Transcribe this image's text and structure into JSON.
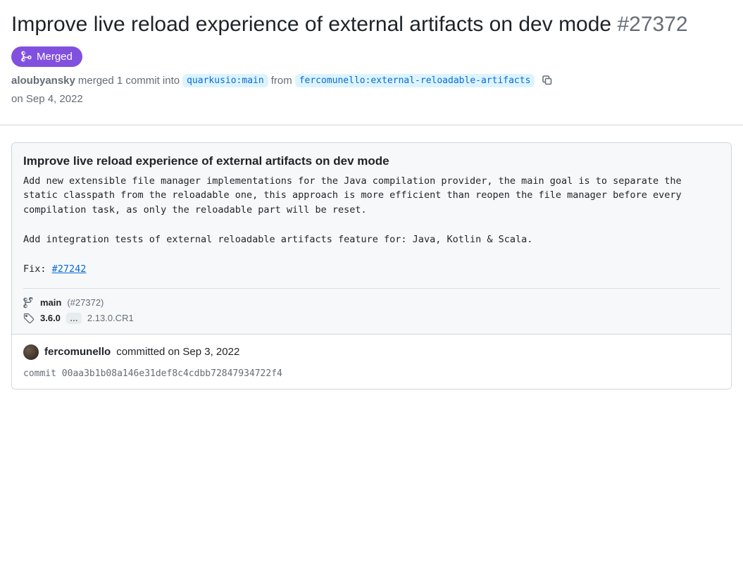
{
  "header": {
    "title": "Improve live reload experience of external artifacts on dev mode",
    "issue_number": "#27372"
  },
  "state": {
    "label": "Merged"
  },
  "merge_info": {
    "merger": "aloubyansky",
    "action_text": "merged 1 commit into",
    "base_branch": "quarkusio:main",
    "from_text": "from",
    "head_branch": "fercomunello:external-reloadable-artifacts",
    "date_text": "on Sep 4, 2022"
  },
  "commit": {
    "title": "Improve live reload experience of external artifacts on dev mode",
    "body_part1": "Add new extensible file manager implementations for the Java compilation provider, the main goal is to separate the static classpath from the reloadable one, this approach is more efficient than reopen the file manager before every compilation task, as only the reloadable part will be reset.\n\nAdd integration tests of external reloadable artifacts feature for: Java, Kotlin & Scala.\n\nFix: ",
    "fix_link": "#27242",
    "refs": {
      "branch_name": "main",
      "branch_pr": "(#27372)",
      "tag_primary": "3.6.0",
      "tag_secondary": "2.13.0.CR1"
    },
    "meta": {
      "author": "fercomunello",
      "committed_text": "committed on Sep 3, 2022",
      "sha_label": "commit",
      "sha": "00aa3b1b08a146e31def8c4cdbb72847934722f4"
    }
  }
}
